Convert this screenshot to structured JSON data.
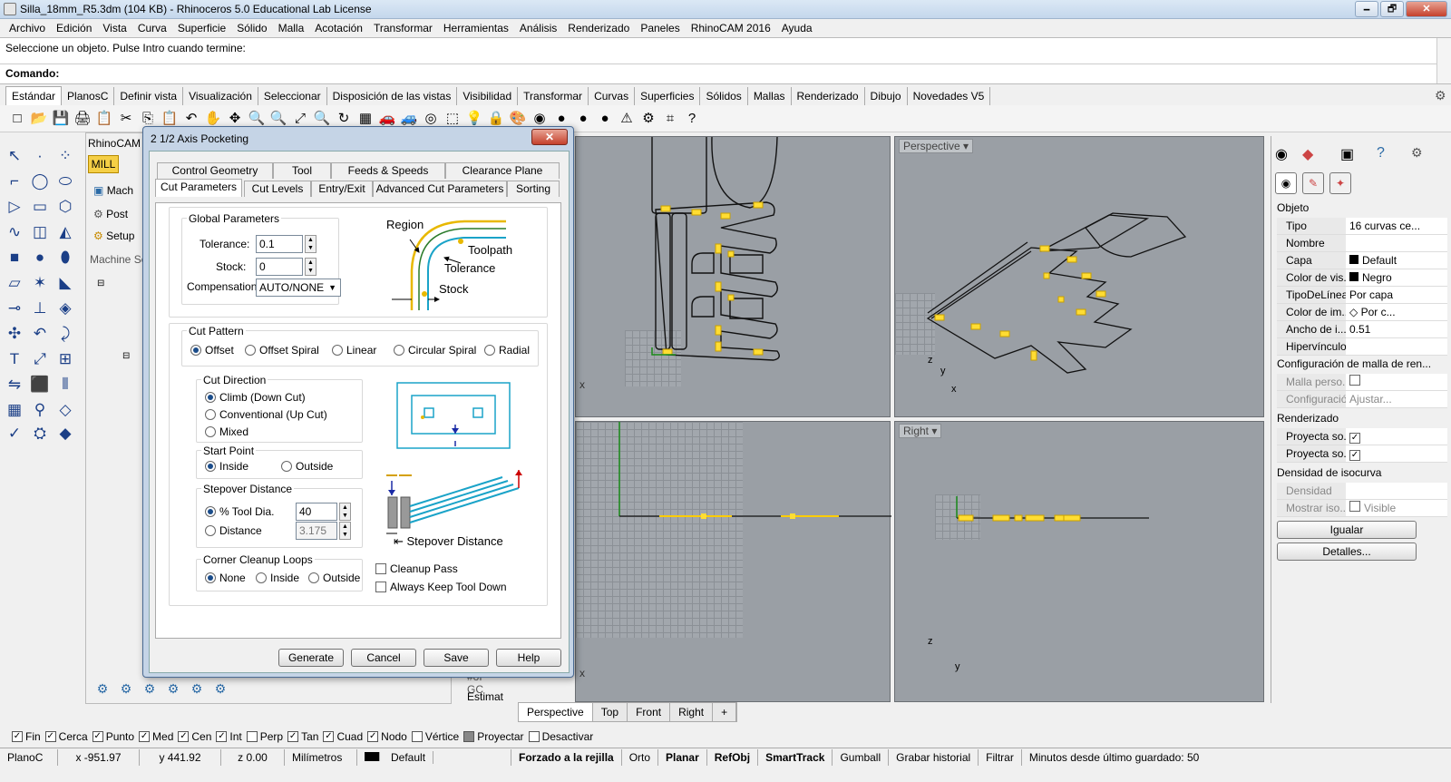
{
  "window": {
    "title": "Silla_18mm_R5.3dm (104 KB) - Rhinoceros 5.0 Educational Lab License",
    "min": "🗕",
    "max": "🗗",
    "close": "✕"
  },
  "menu": [
    "Archivo",
    "Edición",
    "Vista",
    "Curva",
    "Superficie",
    "Sólido",
    "Malla",
    "Acotación",
    "Transformar",
    "Herramientas",
    "Análisis",
    "Renderizado",
    "Paneles",
    "RhinoCAM 2016",
    "Ayuda"
  ],
  "command": {
    "prompt": "Seleccione un objeto. Pulse Intro cuando termine:",
    "label": "Comando:"
  },
  "toolbar_tabs": [
    "Estándar",
    "PlanosC",
    "Definir vista",
    "Visualización",
    "Seleccionar",
    "Disposición de las vistas",
    "Visibilidad",
    "Transformar",
    "Curvas",
    "Superficies",
    "Sólidos",
    "Mallas",
    "Renderizado",
    "Dibujo",
    "Novedades V5"
  ],
  "toolbar_icons": [
    "□",
    "📂",
    "💾",
    "🖨",
    "📋",
    "✂",
    "⎘",
    "📋",
    "↶",
    "✋",
    "✥",
    "🔍",
    "🔍",
    "⤢",
    "🔍",
    "↻",
    "▦",
    "🚗",
    "🚙",
    "◎",
    "⬚",
    "💡",
    "🔒",
    "🎨",
    "◉",
    "●",
    "●",
    "●",
    "⚠",
    "⚙",
    "⌗",
    "?"
  ],
  "rhinocam": {
    "title": "RhinoCAM",
    "mill": "MILL",
    "items": [
      "Mach",
      "Post",
      "Setup"
    ],
    "machine": "Machine Se",
    "bottom_items": [
      "#of GC",
      "Estimat"
    ]
  },
  "bottom_icons": [
    "⚙",
    "⚙",
    "⚙",
    "⚙",
    "⚙",
    "⚙"
  ],
  "dialog": {
    "title": "2 1/2 Axis Pocketing",
    "close": "✕",
    "tabs_row1": [
      "Control Geometry",
      "Tool",
      "Feeds & Speeds",
      "Clearance Plane"
    ],
    "tabs_row2": [
      "Cut Parameters",
      "Cut Levels",
      "Entry/Exit",
      "Advanced Cut Parameters",
      "Sorting"
    ],
    "global": {
      "title": "Global Parameters",
      "tolerance_label": "Tolerance:",
      "tolerance": "0.1",
      "stock_label": "Stock:",
      "stock": "0",
      "comp_label": "Compensation:",
      "comp": "AUTO/NONE"
    },
    "diagram1": {
      "region": "Region",
      "toolpath": "Toolpath",
      "tolerance": "Tolerance",
      "stock": "Stock"
    },
    "cut_pattern": {
      "title": "Cut Pattern",
      "options": [
        "Offset",
        "Offset Spiral",
        "Linear",
        "Circular Spiral",
        "Radial"
      ]
    },
    "cut_direction": {
      "title": "Cut Direction",
      "options": [
        "Climb (Down Cut)",
        "Conventional (Up Cut)",
        "Mixed"
      ]
    },
    "start_point": {
      "title": "Start Point",
      "options": [
        "Inside",
        "Outside"
      ]
    },
    "stepover": {
      "title": "Stepover Distance",
      "opt1": "% Tool Dia.",
      "val1": "40",
      "opt2": "Distance",
      "val2": "3.175",
      "diagram_label": "Stepover Distance"
    },
    "corner": {
      "title": "Corner Cleanup Loops",
      "options": [
        "None",
        "Inside",
        "Outside"
      ]
    },
    "cleanup": "Cleanup Pass",
    "keep_down": "Always Keep Tool Down",
    "buttons": [
      "Generate",
      "Cancel",
      "Save",
      "Help"
    ]
  },
  "viewports": {
    "top": "Top",
    "perspective": "Perspective",
    "front": "Front",
    "right": "Right",
    "x": "x",
    "y": "y",
    "z": "z"
  },
  "viewport_tabs": [
    "Perspective",
    "Top",
    "Front",
    "Right",
    "+"
  ],
  "props": {
    "section_obj": "Objeto",
    "rows": [
      [
        "Tipo",
        "16 curvas ce..."
      ],
      [
        "Nombre",
        ""
      ],
      [
        "Capa",
        "Default"
      ],
      [
        "Color de vis...",
        "Negro"
      ],
      [
        "TipoDeLínea",
        "Por capa"
      ],
      [
        "Color de im...",
        "Por c..."
      ],
      [
        "Ancho de i...",
        "0.51"
      ],
      [
        "Hipervínculo",
        ""
      ]
    ],
    "mesh_title": "Configuración de malla de ren...",
    "mesh_rows": [
      [
        "Malla perso...",
        ""
      ],
      [
        "Configuración",
        "Ajustar..."
      ]
    ],
    "render_title": "Renderizado",
    "render_rows": [
      [
        "Proyecta so...",
        ""
      ],
      [
        "Proyecta so...",
        ""
      ]
    ],
    "iso_title": "Densidad de isocurva",
    "iso_rows": [
      [
        "Densidad",
        ""
      ],
      [
        "Mostrar iso...",
        "Visible"
      ]
    ],
    "btn1": "Igualar",
    "btn2": "Detalles..."
  },
  "snaps": [
    [
      "Fin",
      true
    ],
    [
      "Cerca",
      true
    ],
    [
      "Punto",
      true
    ],
    [
      "Med",
      true
    ],
    [
      "Cen",
      true
    ],
    [
      "Int",
      true
    ],
    [
      "Perp",
      false
    ],
    [
      "Tan",
      true
    ],
    [
      "Cuad",
      true
    ],
    [
      "Nodo",
      true
    ],
    [
      "Vértice",
      false
    ],
    [
      "Proyectar",
      false
    ],
    [
      "Desactivar",
      false
    ]
  ],
  "status": {
    "plane": "PlanoC",
    "x": "x -951.97",
    "y": "y 441.92",
    "z": "z 0.00",
    "units": "Milímetros",
    "layer": "Default",
    "grid": "Forzado a la rejilla",
    "orto": "Orto",
    "planar": "Planar",
    "refobj": "RefObj",
    "smarttrack": "SmartTrack",
    "gumball": "Gumball",
    "history": "Grabar historial",
    "filter": "Filtrar",
    "saved": "Minutos desde último guardado: 50"
  }
}
